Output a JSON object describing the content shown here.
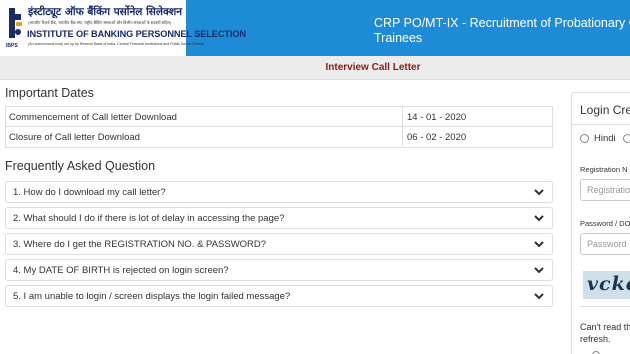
{
  "header": {
    "logo": {
      "hindi_name": "इंस्टीट्यूट ऑफ बैंकिंग पर्सोनेल सिलेक्शन",
      "hindi_subtitle": "(भारतीय रिज़र्व बैंक, भारतीय बैंक संघ, राष्ट्रीय बैंकिंग संस्थाओं और वित्तीय संस्थाओं के सदस्यों सहित)",
      "english_name": "INSTITUTE OF BANKING PERSONNEL SELECTION",
      "english_tagline": "(An autonomous body set up by Reserve Bank of India, Central Financial Institutions and Public Sector Banks)",
      "abbr": "IBPS"
    },
    "title_line1": "CRP PO/MT-IX - Recruitment of Probationary Offic",
    "title_line2": "Trainees",
    "bg_color": "#1e8bd6"
  },
  "subheader": {
    "title": "Interview Call Letter",
    "title_color": "#8b1a1a"
  },
  "important_dates": {
    "heading": "Important Dates",
    "rows": [
      {
        "label": "Commencement of Call letter Download",
        "value": "14 - 01 - 2020"
      },
      {
        "label": "Closure of Call letter Download",
        "value": "06 - 02 - 2020"
      }
    ]
  },
  "faq": {
    "heading": "Frequently Asked Question",
    "items": [
      {
        "question": "1. How do I download my call letter?"
      },
      {
        "question": "2. What should I do if there is lot of delay in accessing the page?"
      },
      {
        "question": "3. Where do I get the REGISTRATION NO. & PASSWORD?"
      },
      {
        "question": "4. My DATE OF BIRTH is rejected on login screen?"
      },
      {
        "question": "5. I am unable to login / screen displays the login failed message?"
      }
    ]
  },
  "login": {
    "title": "Login Cre",
    "radio_hindi": "Hindi",
    "reg_label": "Registration N",
    "reg_placeholder": "Registratio",
    "password_label": "Password / DO",
    "password_placeholder": "Password",
    "captcha_text": "vckc",
    "captcha_note_line1": "Can't read th",
    "captcha_note_line2": "refresh."
  }
}
